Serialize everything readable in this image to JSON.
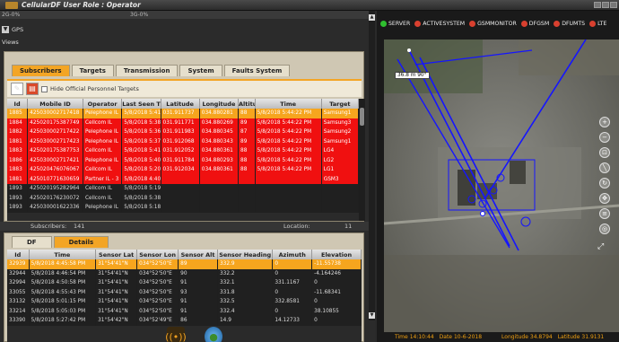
{
  "titlebar": {
    "title": "CellularDF   User Role : Operator"
  },
  "status": {
    "left": "2G-0%",
    "mid": "3G-0%"
  },
  "gps": {
    "label": "GPS"
  },
  "views": {
    "label": "Views"
  },
  "tabs": [
    {
      "label": "Subscribers"
    },
    {
      "label": "Targets"
    },
    {
      "label": "Transmission"
    },
    {
      "label": "System"
    },
    {
      "label": "Faults System"
    }
  ],
  "toolbar": {
    "checkbox_label": "Hide Official Personnel Targets"
  },
  "subscribers_table": {
    "columns": [
      "Id",
      "Mobile ID",
      "Operator",
      "Last Seen Tin",
      "Latitude",
      "Longitude",
      "Altitu",
      "Time",
      "Target"
    ],
    "rows": [
      {
        "style": "sel",
        "cells": [
          "1885",
          "425030002717418",
          "Pelephone IL",
          "5/8/2018 5:41:1",
          "031.911737",
          "034.880281",
          "88",
          "5/8/2018 5:44:22 PM",
          "Samsung1"
        ]
      },
      {
        "style": "red",
        "cells": [
          "1884",
          "425020175387749",
          "Cellcom IL",
          "5/8/2018 5:38:5",
          "031.911771",
          "034.880269",
          "89",
          "5/8/2018 5:44:22 PM",
          "Samsung3"
        ]
      },
      {
        "style": "red",
        "cells": [
          "1882",
          "425030002717422",
          "Pelephone IL",
          "5/8/2018 5:36:1",
          "031.911983",
          "034.880345",
          "87",
          "5/8/2018 5:44:22 PM",
          "Samsung2"
        ]
      },
      {
        "style": "red",
        "cells": [
          "1881",
          "425030002717423",
          "Pelephone IL",
          "5/8/2018 5:37:0",
          "031.912068",
          "034.880343",
          "89",
          "5/8/2018 5:44:22 PM",
          "Samsung1"
        ]
      },
      {
        "style": "red",
        "cells": [
          "1883",
          "425020175387753",
          "Cellcom IL",
          "5/8/2018 5:41:5",
          "031.912052",
          "034.880361",
          "88",
          "5/8/2018 5:44:22 PM",
          "LG4"
        ]
      },
      {
        "style": "red",
        "cells": [
          "1886",
          "425030002717421",
          "Pelephone IL",
          "5/8/2018 5:40:2",
          "031.911784",
          "034.880293",
          "88",
          "5/8/2018 5:44:22 PM",
          "LG2"
        ]
      },
      {
        "style": "red",
        "cells": [
          "1883",
          "425020476076067",
          "Cellcom IL",
          "5/8/2018 5:20:0",
          "031.912034",
          "034.880361",
          "88",
          "5/8/2018 5:44:22 PM",
          "LG1"
        ]
      },
      {
        "style": "red",
        "cells": [
          "1881",
          "425010771630659",
          "Partner IL - 3",
          "5/8/2018 4:40:2",
          "",
          "",
          "",
          "",
          "GSM3"
        ]
      },
      {
        "style": "dark",
        "cells": [
          "1893",
          "425020195282964",
          "Cellcom IL",
          "5/8/2018 5:19:",
          "",
          "",
          "",
          "",
          ""
        ]
      },
      {
        "style": "dark",
        "cells": [
          "1893",
          "425020176230072",
          "Cellcom IL",
          "5/8/2018 5:38:1",
          "",
          "",
          "",
          "",
          ""
        ]
      },
      {
        "style": "dark",
        "cells": [
          "1893",
          "425030001622336",
          "Pelephone IL",
          "5/8/2018 5:18:1",
          "",
          "",
          "",
          "",
          ""
        ]
      }
    ]
  },
  "subscribers_footer": {
    "label": "Subscribers:",
    "count": "141",
    "location_label": "Location:",
    "location_value": "11"
  },
  "df_tabs": [
    {
      "label": "DF"
    },
    {
      "label": "Details"
    }
  ],
  "df_table": {
    "columns": [
      "Id",
      "Time",
      "Sensor Lat",
      "Sensor Lon",
      "Sensor Alt",
      "Sensor Heading",
      "Azimuth",
      "Elevation"
    ],
    "rows": [
      {
        "style": "sel",
        "cells": [
          "32939",
          "5/8/2018 4:45:58 PM",
          "31°54'41\"N",
          "034°52'50\"E",
          "89",
          "332.9",
          "0",
          "-11.55738"
        ]
      },
      {
        "style": "dark",
        "cells": [
          "32944",
          "5/8/2018 4:46:54 PM",
          "31°54'41\"N",
          "034°52'50\"E",
          "90",
          "332.2",
          "0",
          "-4.164246"
        ]
      },
      {
        "style": "dark",
        "cells": [
          "32994",
          "5/8/2018 4:50:58 PM",
          "31°54'41\"N",
          "034°52'50\"E",
          "91",
          "332.1",
          "331.1167",
          "0"
        ]
      },
      {
        "style": "dark",
        "cells": [
          "33055",
          "5/8/2018 4:55:43 PM",
          "31°54'41\"N",
          "034°52'50\"E",
          "93",
          "331.8",
          "0",
          "-11.68341"
        ]
      },
      {
        "style": "dark",
        "cells": [
          "33132",
          "5/8/2018 5:01:15 PM",
          "31°54'41\"N",
          "034°52'50\"E",
          "91",
          "332.5",
          "332.8581",
          "0"
        ]
      },
      {
        "style": "dark",
        "cells": [
          "33214",
          "5/8/2018 5:05:03 PM",
          "31°54'41\"N",
          "034°52'50\"E",
          "91",
          "332.4",
          "0",
          "38.10855"
        ]
      },
      {
        "style": "dark",
        "cells": [
          "33390",
          "5/8/2018 5:27:42 PM",
          "31°54'42\"N",
          "034°52'49\"E",
          "86",
          "14.9",
          "14.12733",
          "0"
        ]
      }
    ]
  },
  "legend": [
    {
      "label": "SERVER",
      "color": "#2fbf2f"
    },
    {
      "label": "ACTIVESYSTEM",
      "color": "#d9402f"
    },
    {
      "label": "GSMMONITOR",
      "color": "#d9402f"
    },
    {
      "label": "DFGSM",
      "color": "#d9402f"
    },
    {
      "label": "DFUMTS",
      "color": "#d9402f"
    },
    {
      "label": "LTE",
      "color": "#d9402f"
    }
  ],
  "map": {
    "zoom_readout": "36.8 m   90°"
  },
  "mapstatus": {
    "time_label": "Time",
    "time": "14:10:44",
    "date_label": "Date",
    "date": "10-6-2018",
    "lon_label": "Longitude",
    "lon": "34.8794",
    "lat_label": "Latitude",
    "lat": "31.9131"
  }
}
